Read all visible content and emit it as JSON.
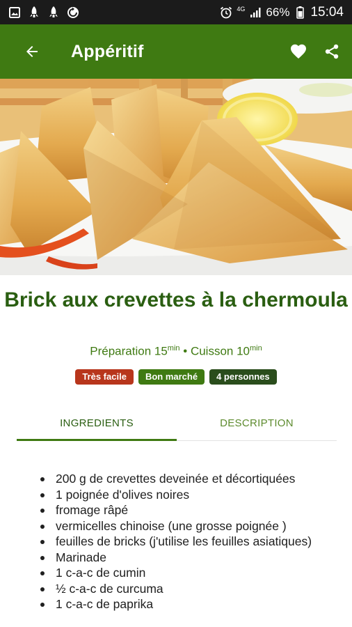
{
  "status_bar": {
    "network": "4G",
    "battery": "66%",
    "time": "15:04",
    "icons": [
      "gallery-icon",
      "rocket-icon",
      "rocket-icon",
      "refresh-icon",
      "alarm-icon",
      "signal-icon",
      "battery-icon"
    ]
  },
  "app_bar": {
    "title": "Appéritif",
    "back_icon": "arrow-back-icon",
    "favorite_icon": "heart-icon",
    "share_icon": "share-icon"
  },
  "recipe": {
    "title": "Brick aux crevettes à la chermoula",
    "prep_label": "Préparation 15",
    "prep_unit": "min",
    "separator": " • ",
    "cook_label": "Cuisson 10",
    "cook_unit": "min"
  },
  "badges": [
    {
      "label": "Très facile",
      "color": "#b8361c"
    },
    {
      "label": "Bon marché",
      "color": "#3f7a12"
    },
    {
      "label": "4 personnes",
      "color": "#2a4d1c"
    }
  ],
  "tabs": [
    {
      "label": "INGREDIENTS",
      "active": true
    },
    {
      "label": "DESCRIPTION",
      "active": false
    }
  ],
  "ingredients": [
    "200 g de crevettes deveinée et décortiquées",
    "1 poignée d'olives noires",
    "fromage râpé",
    "vermicelles chinoise (une grosse poignée )",
    "feuilles de bricks (j'utilise les feuilles asiatiques)",
    "Marinade",
    "1 c-a-c de cumin",
    "½ c-a-c de curcuma",
    "1 c-a-c de paprika"
  ],
  "colors": {
    "primary": "#3f7a12",
    "title": "#2a5e11",
    "status_bar": "#1b1b1b"
  }
}
